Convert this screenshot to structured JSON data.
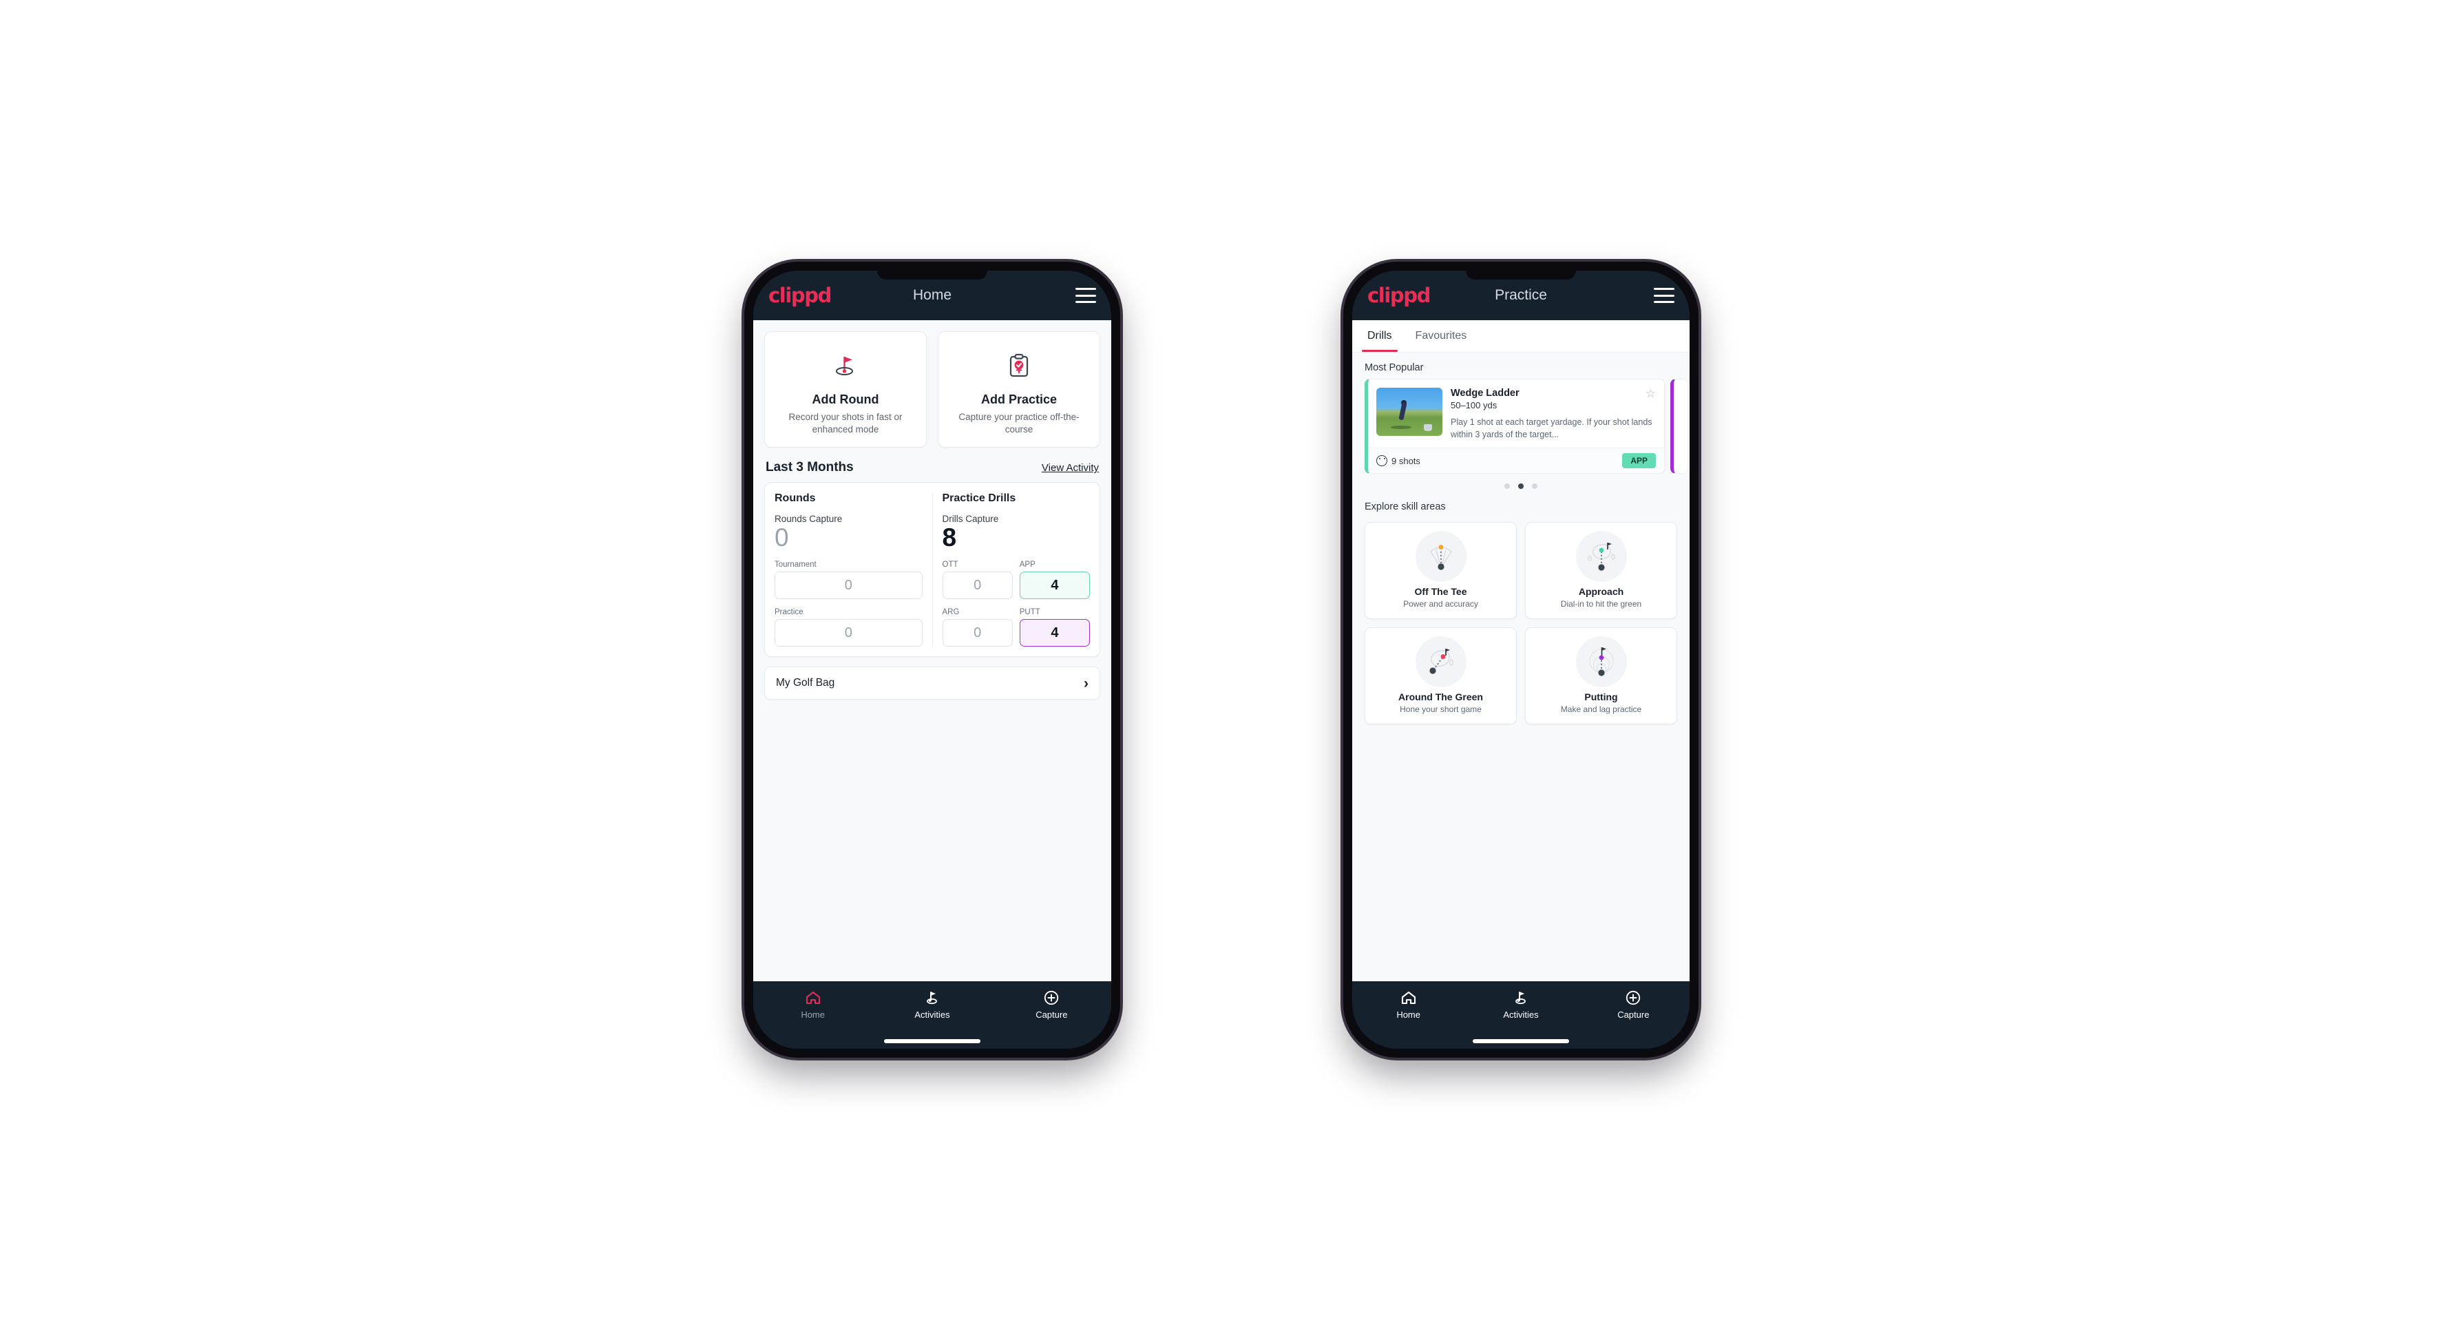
{
  "brand": {
    "logo_text": "clippd",
    "accent": "#ed2c56",
    "dark": "#16212e"
  },
  "phone_home": {
    "appbar": {
      "title": "Home",
      "menu_icon": "hamburger-icon"
    },
    "quick_actions": [
      {
        "icon": "golf-flag-hole-icon",
        "title": "Add Round",
        "subtitle": "Record your shots in fast or enhanced mode"
      },
      {
        "icon": "clipboard-check-icon",
        "title": "Add Practice",
        "subtitle": "Capture your practice off-the-course"
      }
    ],
    "section": {
      "title": "Last 3 Months",
      "link": "View Activity"
    },
    "rounds": {
      "title": "Rounds",
      "capture_label": "Rounds Capture",
      "capture_value": "0",
      "fields": [
        {
          "label": "Tournament",
          "value": "0",
          "accent": "none"
        },
        {
          "label": "Practice",
          "value": "0",
          "accent": "none"
        }
      ]
    },
    "drills": {
      "title": "Practice Drills",
      "capture_label": "Drills Capture",
      "capture_value": "8",
      "fields": [
        {
          "label": "OTT",
          "value": "0",
          "accent": "none"
        },
        {
          "label": "APP",
          "value": "4",
          "accent": "green"
        },
        {
          "label": "ARG",
          "value": "0",
          "accent": "none"
        },
        {
          "label": "PUTT",
          "value": "4",
          "accent": "purple"
        }
      ]
    },
    "golf_bag": {
      "label": "My Golf Bag",
      "chevron": "chevron-right-icon"
    },
    "bottom_nav": [
      {
        "icon": "home-icon",
        "label": "Home",
        "active": true
      },
      {
        "icon": "golf-flag-icon",
        "label": "Activities",
        "active": false
      },
      {
        "icon": "plus-circle-icon",
        "label": "Capture",
        "active": false
      }
    ]
  },
  "phone_practice": {
    "appbar": {
      "title": "Practice",
      "menu_icon": "hamburger-icon"
    },
    "tabs": [
      {
        "label": "Drills",
        "active": true
      },
      {
        "label": "Favourites",
        "active": false
      }
    ],
    "most_popular_label": "Most Popular",
    "drill": {
      "title": "Wedge Ladder",
      "yardage": "50–100 yds",
      "description": "Play 1 shot at each target yardage. If your shot lands within 3 yards of the target...",
      "shots": "9 shots",
      "tag": "APP",
      "tag_color": "#63dcb3",
      "accent_color": "#5fd5ac",
      "star_icon": "star-outline-icon",
      "thumb_icon": "golfer-photo"
    },
    "peek_accent_color": "#a22ad4",
    "carousel_dots": {
      "count": 3,
      "active_index": 1
    },
    "explore_label": "Explore skill areas",
    "skill_areas": [
      {
        "icon": "tee-shot-fan-icon",
        "title": "Off The Tee",
        "subtitle": "Power and accuracy",
        "dot_color": "#f5a623"
      },
      {
        "icon": "green-approach-icon",
        "title": "Approach",
        "subtitle": "Dial-in to hit the green",
        "dot_color": "#3ecfa4"
      },
      {
        "icon": "chip-around-green-icon",
        "title": "Around The Green",
        "subtitle": "Hone your short game",
        "dot_color": "#ef3b5b"
      },
      {
        "icon": "putting-rings-icon",
        "title": "Putting",
        "subtitle": "Make and lag practice",
        "dot_color": "#a22ad4"
      }
    ],
    "bottom_nav": [
      {
        "icon": "home-icon",
        "label": "Home",
        "active": false
      },
      {
        "icon": "golf-flag-icon",
        "label": "Activities",
        "active": true
      },
      {
        "icon": "plus-circle-icon",
        "label": "Capture",
        "active": false
      }
    ]
  }
}
